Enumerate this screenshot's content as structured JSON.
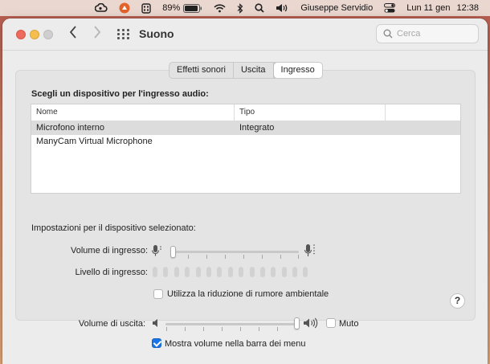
{
  "menubar": {
    "battery": "89%",
    "user": "Giuseppe Servidio",
    "date": "Lun 11 gen",
    "time": "12:38"
  },
  "window": {
    "title": "Suono",
    "search_placeholder": "Cerca"
  },
  "tabs": [
    {
      "label": "Effetti sonori",
      "active": false
    },
    {
      "label": "Uscita",
      "active": false
    },
    {
      "label": "Ingresso",
      "active": true
    }
  ],
  "input_panel": {
    "heading": "Scegli un dispositivo per l'ingresso audio:",
    "columns": [
      "Nome",
      "Tipo"
    ],
    "devices": [
      {
        "name": "Microfono interno",
        "type": "Integrato",
        "selected": true
      },
      {
        "name": "ManyCam Virtual Microphone",
        "type": "",
        "selected": false
      }
    ],
    "settings_heading": "Impostazioni per il dispositivo selezionato:",
    "input_volume_label": "Volume di ingresso:",
    "input_volume_value": 0.02,
    "input_level_label": "Livello di ingresso:",
    "input_level_value": 0,
    "noise_reduction_label": "Utilizza la riduzione di rumore ambientale",
    "noise_reduction_checked": false,
    "help_label": "?"
  },
  "output": {
    "volume_label": "Volume di uscita:",
    "volume_value": 1.0,
    "mute_label": "Muto",
    "mute_checked": false,
    "show_volume_label": "Mostra volume nella barra dei menu",
    "show_volume_checked": true
  },
  "colors": {
    "accent": "#1a73e8",
    "selected_row": "#dcdcdc",
    "close": "#ed6a5e",
    "minimize": "#f4bf4f"
  }
}
